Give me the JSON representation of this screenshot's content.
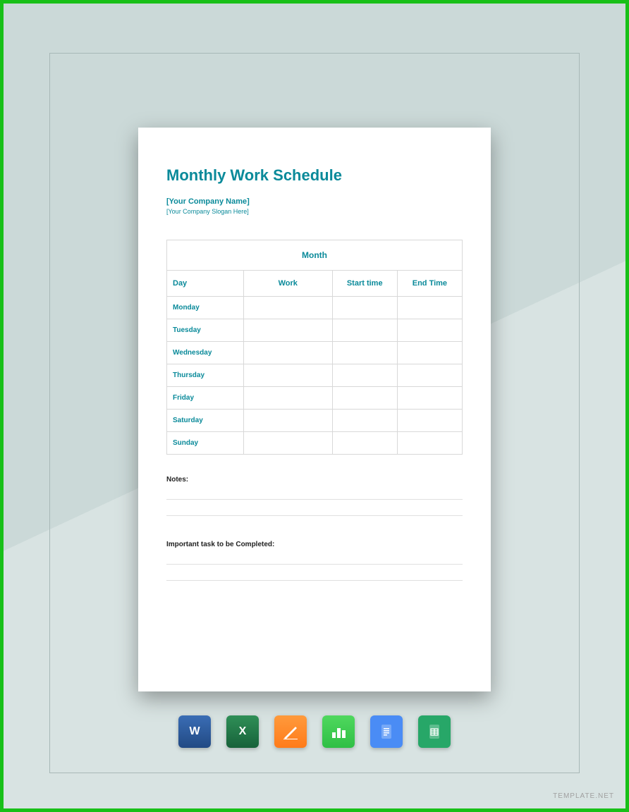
{
  "document": {
    "title": "Monthly Work Schedule",
    "company_name": "[Your Company Name]",
    "company_slogan": "[Your Company Slogan Here]",
    "table": {
      "month_header": "Month",
      "columns": [
        "Day",
        "Work",
        "Start time",
        "End Time"
      ],
      "days": [
        "Monday",
        "Tuesday",
        "Wednesday",
        "Thursday",
        "Friday",
        "Saturday",
        "Sunday"
      ]
    },
    "notes_label": "Notes:",
    "tasks_label": "Important task to be Completed:"
  },
  "apps": [
    {
      "name": "word",
      "label": "W"
    },
    {
      "name": "excel",
      "label": "X"
    },
    {
      "name": "pages",
      "label": ""
    },
    {
      "name": "numbers",
      "label": ""
    },
    {
      "name": "docs",
      "label": ""
    },
    {
      "name": "sheets",
      "label": ""
    }
  ],
  "watermark": "TEMPLATE.NET"
}
